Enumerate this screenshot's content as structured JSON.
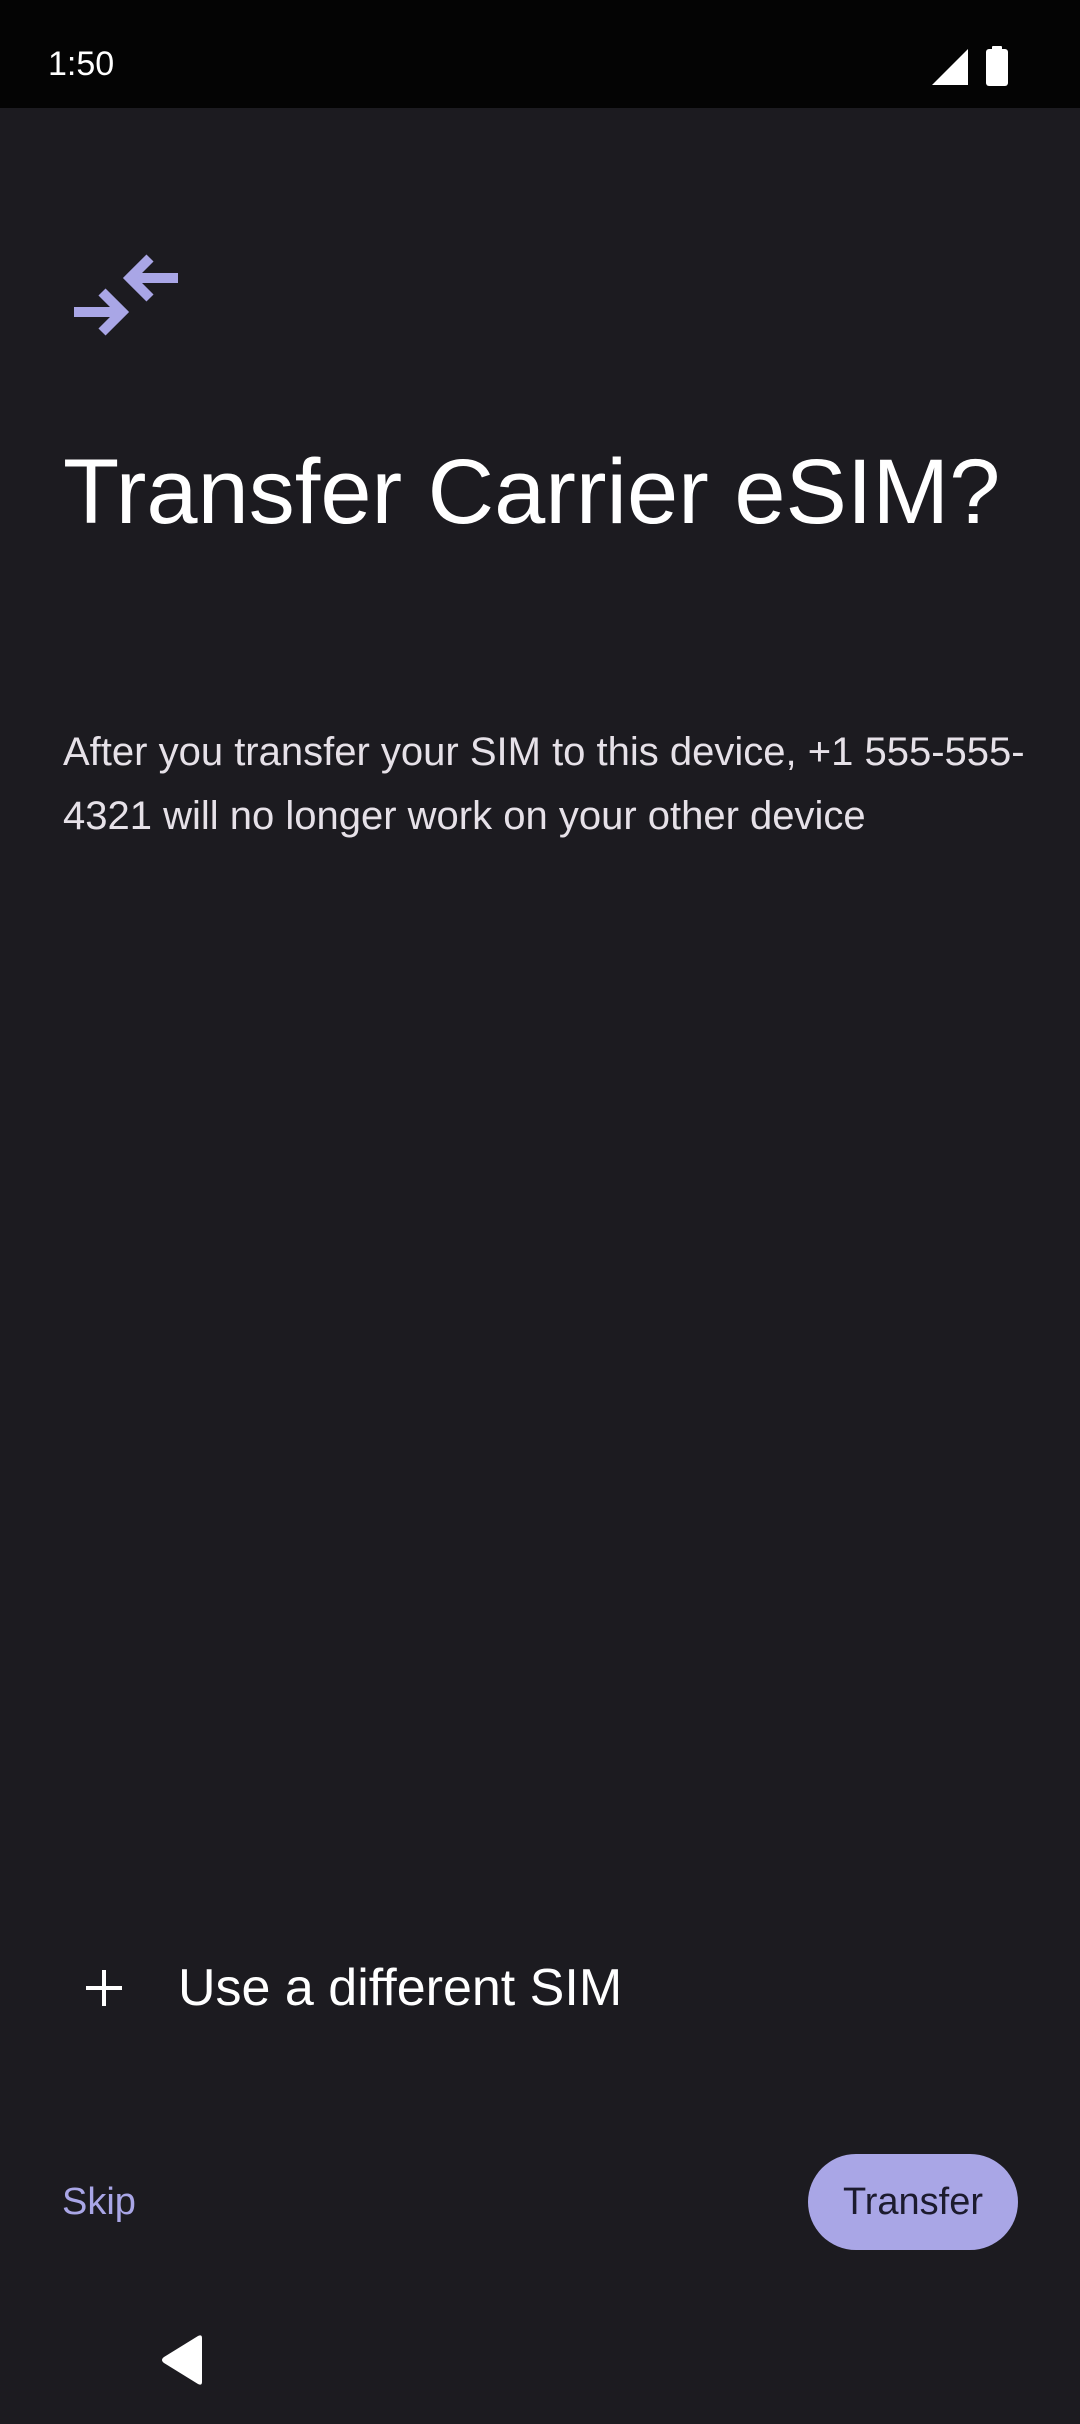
{
  "status_bar": {
    "time": "1:50",
    "signal_icon": "cell-signal-full-icon",
    "battery_icon": "battery-full-icon"
  },
  "header_icon": "swap-arrows-icon",
  "title": "Transfer Carrier eSIM?",
  "description": "After you transfer your SIM to this device, +1 555-555-4321 will no longer work on your other device",
  "different_sim": {
    "icon": "plus-icon",
    "label": "Use a different SIM"
  },
  "footer": {
    "skip_label": "Skip",
    "transfer_label": "Transfer"
  },
  "navigation": {
    "back_icon": "back-triangle-icon"
  },
  "colors": {
    "background": "#1c1b20",
    "status_bar": "#040404",
    "accent": "#a9a6e6"
  }
}
